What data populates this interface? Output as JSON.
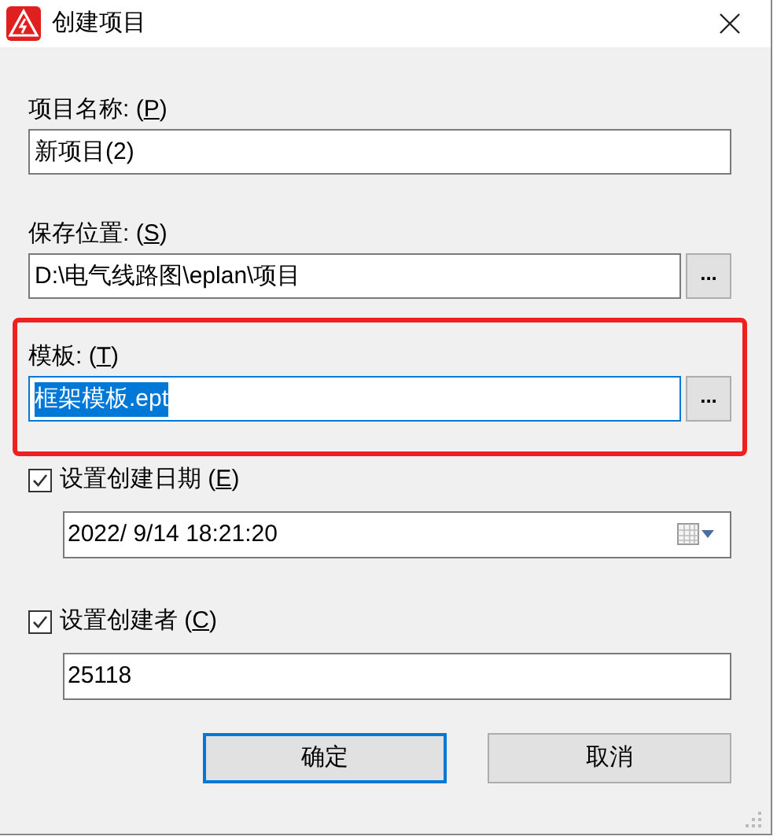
{
  "window": {
    "title": "创建项目"
  },
  "fields": [
    {
      "kind": "text",
      "label": "项目名称: (",
      "mnemonic": "P",
      "label_end": ")",
      "value": "新项目(2)",
      "browse": false,
      "highlighted": false,
      "value_selected": false
    },
    {
      "kind": "text",
      "label": "保存位置: (",
      "mnemonic": "S",
      "label_end": ")",
      "value": "D:\\电气线路图\\eplan\\项目",
      "browse": true,
      "browse_label": "...",
      "highlighted": false,
      "value_selected": false
    },
    {
      "kind": "text",
      "label": "模板: (",
      "mnemonic": "T",
      "label_end": ")",
      "value": "框架模板.ept",
      "browse": true,
      "browse_label": "...",
      "highlighted": true,
      "value_selected": true
    },
    {
      "kind": "check",
      "label": "设置创建日期 (",
      "mnemonic": "E",
      "label_end": ")",
      "checked": true,
      "value": "2022/  9/14 18:21:20",
      "picker": true
    },
    {
      "kind": "check",
      "label": "设置创建者 (",
      "mnemonic": "C",
      "label_end": ")",
      "checked": true,
      "value": "25118",
      "picker": false
    }
  ],
  "buttons": [
    {
      "label": "确定",
      "default": true
    },
    {
      "label": "取消",
      "default": false
    }
  ]
}
